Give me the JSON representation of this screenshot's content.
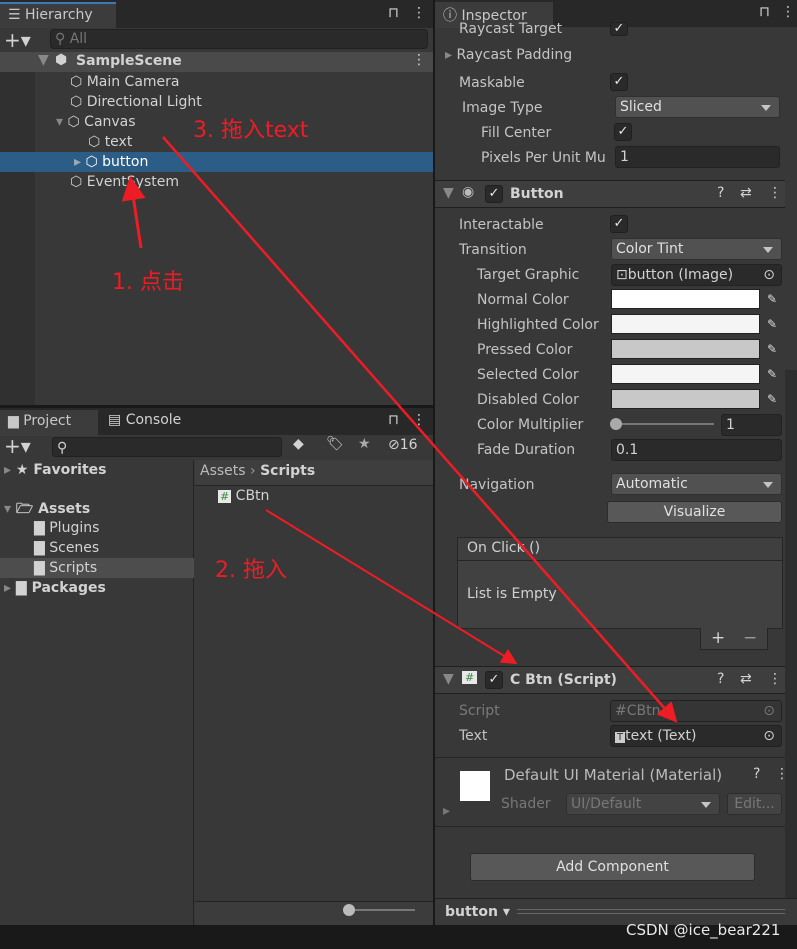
{
  "hierarchy": {
    "title": "Hierarchy",
    "search_placeholder": "All",
    "scene": "SampleScene",
    "items": [
      "Main Camera",
      "Directional Light",
      "Canvas",
      "text",
      "button",
      "EventSystem"
    ]
  },
  "project": {
    "tab": "Project",
    "console_tab": "Console",
    "hidden_count": "16",
    "tree": [
      "Favorites",
      "Assets",
      "Plugins",
      "Scenes",
      "Scripts",
      "Packages"
    ],
    "breadcrumb": [
      "Assets",
      "Scripts"
    ],
    "files": [
      "CBtn"
    ]
  },
  "inspector": {
    "title": "Inspector",
    "image": {
      "raycast_target": "Raycast Target",
      "raycast_padding": "Raycast Padding",
      "maskable": "Maskable",
      "image_type_label": "Image Type",
      "image_type": "Sliced",
      "fill_center": "Fill Center",
      "ppu_label": "Pixels Per Unit Mu",
      "ppu": "1"
    },
    "button": {
      "title": "Button",
      "interactable": "Interactable",
      "transition_label": "Transition",
      "transition": "Color Tint",
      "target_graphic_label": "Target Graphic",
      "target_graphic": "button (Image)",
      "colors": [
        {
          "label": "Normal Color",
          "color": "#ffffff"
        },
        {
          "label": "Highlighted Color",
          "color": "#f5f5f5"
        },
        {
          "label": "Pressed Color",
          "color": "#c8c8c8"
        },
        {
          "label": "Selected Color",
          "color": "#f5f5f5"
        },
        {
          "label": "Disabled Color",
          "color": "#c8c8c8"
        }
      ],
      "multiplier_label": "Color Multiplier",
      "multiplier": "1",
      "fade_label": "Fade Duration",
      "fade": "0.1",
      "navigation_label": "Navigation",
      "navigation": "Automatic",
      "visualize": "Visualize",
      "onclick": "On Click ()",
      "list_empty": "List is Empty",
      "add": "+",
      "remove": "−"
    },
    "script": {
      "title": "C Btn (Script)",
      "script_label": "Script",
      "script_value": "CBtn",
      "text_label": "Text",
      "text_value": "text (Text)"
    },
    "material": {
      "title": "Default UI Material (Material)",
      "shader_label": "Shader",
      "shader": "UI/Default",
      "edit": "Edit..."
    },
    "add_component": "Add Component",
    "footer_object": "button"
  },
  "annotations": {
    "step1": "1. 点击",
    "step2": "2. 拖入",
    "step3": "3. 拖入text",
    "color": "#ee1c24"
  },
  "watermark": "CSDN @ice_bear221"
}
